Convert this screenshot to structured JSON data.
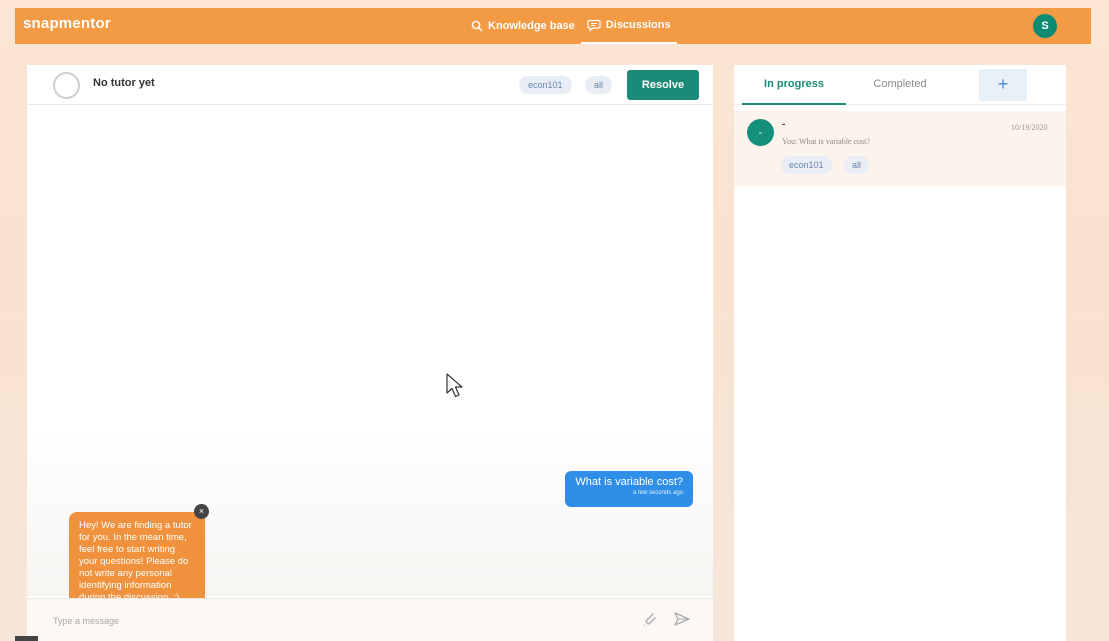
{
  "header": {
    "logo": "snapmentor",
    "nav": [
      {
        "label": "Knowledge base",
        "icon": "search-icon"
      },
      {
        "label": "Discussions",
        "icon": "chat-bubble-icon"
      }
    ],
    "avatar_initial": "S"
  },
  "chat": {
    "tutor_label": "No tutor yet",
    "tags": [
      "econ101",
      "all"
    ],
    "resolve_label": "Resolve",
    "user_message": {
      "text": "What is variable cost?",
      "time": "a few seconds ago"
    },
    "bot_message": "Hey! We are finding a tutor for you. In the mean time, feel free to start writing your questions! Please do not write any personal identifying information during the discussion. :)",
    "close_glyph": "×",
    "input_placeholder": "Type a message"
  },
  "sidebar": {
    "tabs": [
      "In progress",
      "Completed"
    ],
    "add_label": "+",
    "conversations": [
      {
        "avatar": "-",
        "name": "-",
        "preview": "You: What is variable cost?",
        "date": "10/19/2020",
        "tags": [
          "econ101",
          "all"
        ]
      }
    ]
  },
  "colors": {
    "brand_orange": "#f39a44",
    "primary_green": "#1b8a78",
    "message_blue": "#2f8fe8"
  }
}
